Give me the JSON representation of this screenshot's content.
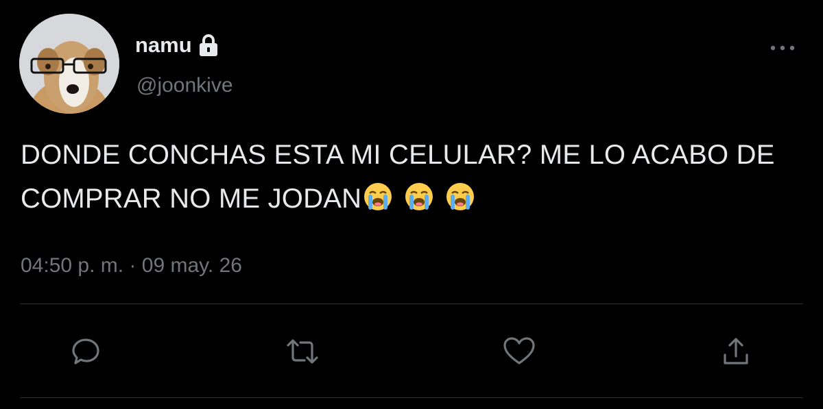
{
  "user": {
    "display_name": "namu",
    "handle": "@joonkive",
    "protected_icon": "lock-icon",
    "avatar": "dog-with-glasses-avatar"
  },
  "tweet": {
    "text": "DONDE CONCHAS ESTA MI CELULAR? ME LO ACABO DE COMPRAR NO ME JODAN",
    "emojis": [
      "😭",
      "😭",
      "😭"
    ],
    "time": "04:50 p. m.",
    "separator": " · ",
    "date": "09 may. 26"
  },
  "actions": {
    "reply": "reply-icon",
    "retweet": "retweet-icon",
    "like": "heart-icon",
    "share": "share-icon",
    "more": "more-options-icon"
  },
  "colors": {
    "background": "#000000",
    "primary_text": "#e7e9ea",
    "secondary_text": "#71767b",
    "divider": "#2f3336"
  }
}
